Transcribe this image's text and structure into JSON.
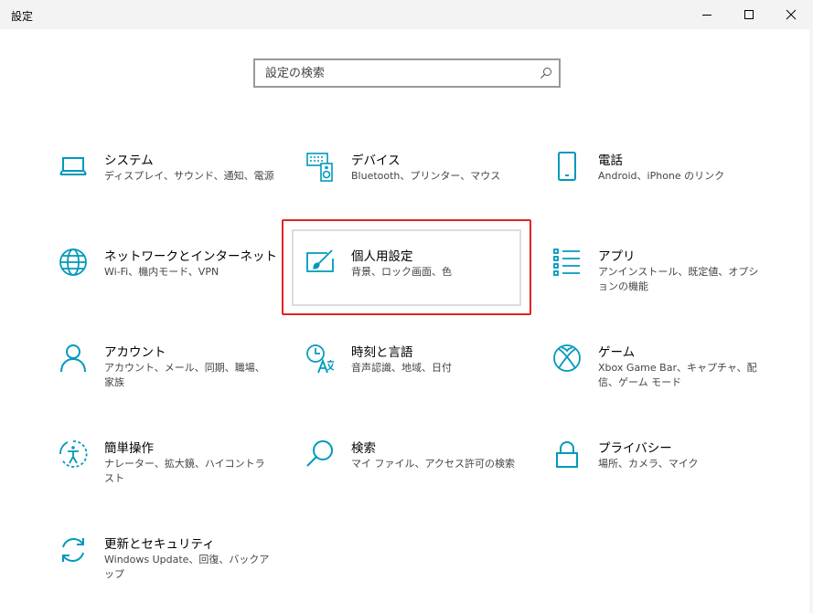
{
  "window": {
    "title": "設定",
    "controls": [
      "minimize",
      "maximize",
      "close"
    ]
  },
  "search": {
    "placeholder": "設定の検索",
    "value": ""
  },
  "colors": {
    "accent": "#0099bc",
    "highlight": "#e32222",
    "titlebar": "#f3f3f3"
  },
  "tiles": [
    {
      "title": "システム",
      "desc": "ディスプレイ、サウンド、通知、電源",
      "icon": "laptop-icon"
    },
    {
      "title": "デバイス",
      "desc": "Bluetooth、プリンター、マウス",
      "icon": "keyboard-speaker-icon"
    },
    {
      "title": "電話",
      "desc": "Android、iPhone のリンク",
      "icon": "phone-icon"
    },
    {
      "title": "ネットワークとインターネット",
      "desc": "Wi-Fi、機内モード、VPN",
      "icon": "globe-icon"
    },
    {
      "title": "個人用設定",
      "desc": "背景、ロック画面、色",
      "icon": "paint-brush-icon"
    },
    {
      "title": "アプリ",
      "desc": "アンインストール、既定値、オプションの機能",
      "icon": "app-list-icon"
    },
    {
      "title": "アカウント",
      "desc": "アカウント、メール、同期、職場、家族",
      "icon": "person-icon"
    },
    {
      "title": "時刻と言語",
      "desc": "音声認識、地域、日付",
      "icon": "time-language-icon"
    },
    {
      "title": "ゲーム",
      "desc": "Xbox Game Bar、キャプチャ、配信、ゲーム モード",
      "icon": "xbox-icon"
    },
    {
      "title": "簡単操作",
      "desc": "ナレーター、拡大鏡、ハイコントラスト",
      "icon": "ease-of-access-icon"
    },
    {
      "title": "検索",
      "desc": "マイ ファイル、アクセス許可の検索",
      "icon": "search-magnifier-icon"
    },
    {
      "title": "プライバシー",
      "desc": "場所、カメラ、マイク",
      "icon": "lock-icon"
    },
    {
      "title": "更新とセキュリティ",
      "desc": "Windows Update、回復、バックアップ",
      "icon": "sync-arrows-icon"
    }
  ]
}
